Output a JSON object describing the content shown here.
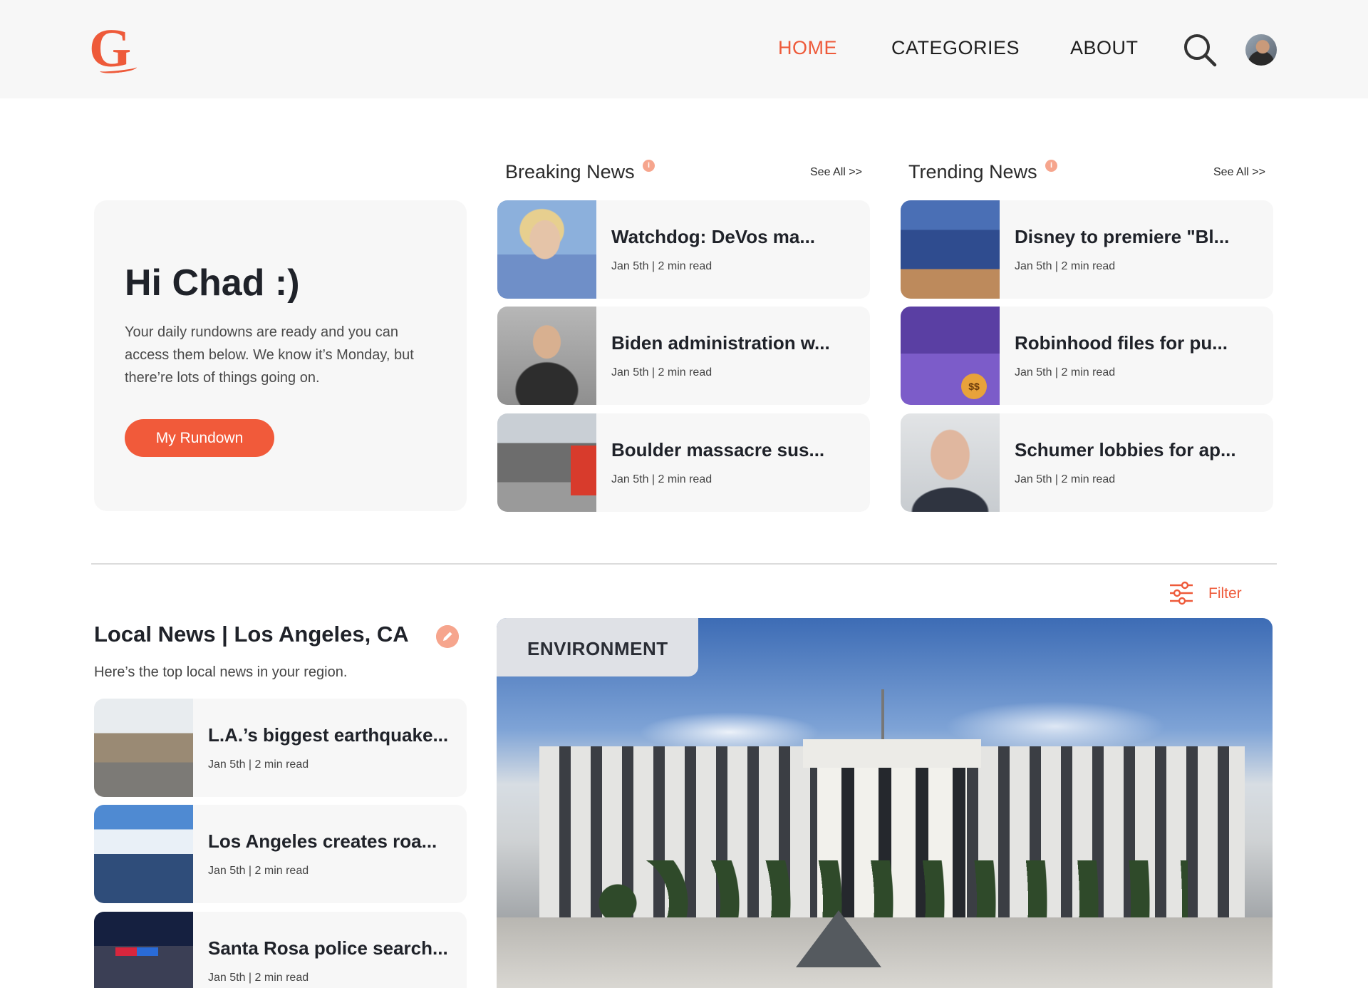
{
  "header": {
    "logo_text": "G",
    "nav": {
      "home": "HOME",
      "categories": "CATEGORIES",
      "about": "ABOUT"
    },
    "accent_color": "#ee5a3a"
  },
  "greeting": {
    "title": "Hi Chad :)",
    "text": "Your daily rundowns are ready and you can access them below. We know it’s Monday, but there’re lots of things going on.",
    "button": "My Rundown"
  },
  "breaking": {
    "title": "Breaking News",
    "see_all": "See All >>",
    "items": [
      {
        "title": "Watchdog: DeVos ma...",
        "meta": "Jan 5th | 2 min read"
      },
      {
        "title": "Biden administration w...",
        "meta": "Jan 5th | 2 min read"
      },
      {
        "title": "Boulder massacre sus...",
        "meta": "Jan 5th | 2 min read"
      }
    ]
  },
  "trending": {
    "title": "Trending News",
    "see_all": "See All >>",
    "items": [
      {
        "title": "Disney to premiere \"Bl...",
        "meta": "Jan 5th | 2 min read"
      },
      {
        "title": "Robinhood files for pu...",
        "meta": "Jan 5th | 2 min read"
      },
      {
        "title": "Schumer lobbies for ap...",
        "meta": "Jan 5th | 2 min read"
      }
    ]
  },
  "filter": {
    "label": "Filter"
  },
  "local": {
    "title": "Local News | Los Angeles, CA",
    "subtitle": "Here’s the top local news in your region.",
    "items": [
      {
        "title": "L.A.’s biggest earthquake...",
        "meta": "Jan 5th | 2 min read"
      },
      {
        "title": "Los Angeles creates roa...",
        "meta": "Jan 5th | 2 min read"
      },
      {
        "title": "Santa Rosa police search...",
        "meta": "Jan 5th | 2 min read"
      }
    ]
  },
  "featured": {
    "category": "ENVIRONMENT"
  }
}
